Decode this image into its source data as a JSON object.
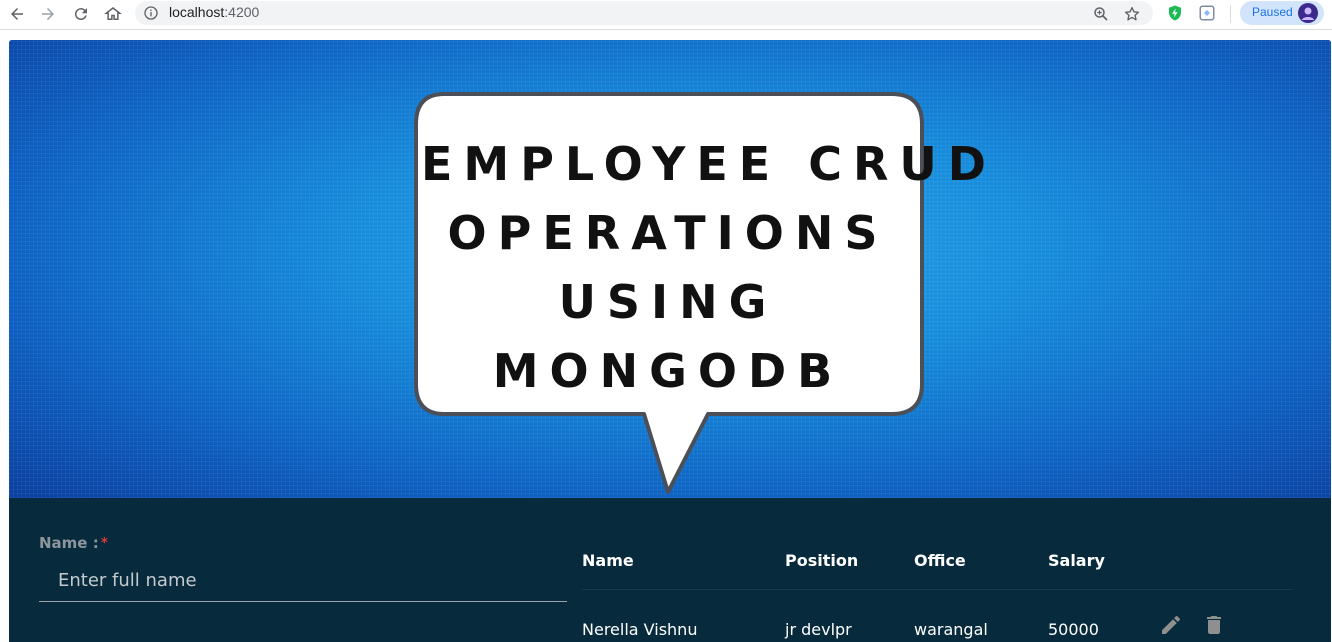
{
  "browser": {
    "url_host": "localhost",
    "url_port": ":4200",
    "profile_status": "Paused",
    "icons": [
      "back-arrow-icon",
      "forward-arrow-icon",
      "reload-icon",
      "home-icon",
      "info-icon",
      "zoom-icon",
      "star-icon",
      "shield-extension-icon",
      "extension-icon",
      "avatar"
    ]
  },
  "banner": {
    "line1": "EMPLOYEE CRUD",
    "line2": "OPERATIONS",
    "line3": "USING",
    "line4": "MONGODB"
  },
  "form": {
    "name_label": "Name :",
    "required_mark": "*",
    "name_placeholder": "Enter full name"
  },
  "table": {
    "headers": [
      "Name",
      "Position",
      "Office",
      "Salary"
    ],
    "rows": [
      {
        "name": "Nerella Vishnu",
        "position": "jr devlpr",
        "office": "warangal",
        "salary": "50000",
        "actions": [
          "edit-icon",
          "delete-icon"
        ]
      }
    ]
  },
  "colors": {
    "page_bg": "#072b3d",
    "action_icon": "#8f8f8f",
    "required": "#e53935"
  }
}
